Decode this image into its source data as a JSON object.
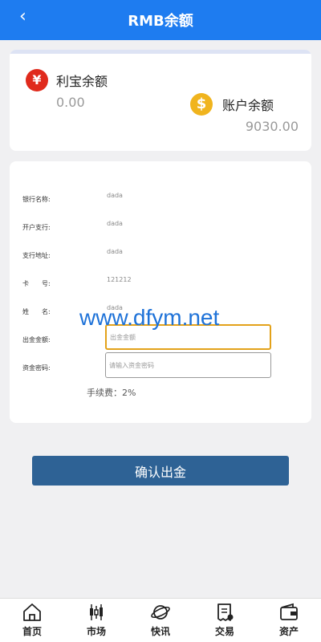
{
  "header": {
    "title": "RMB余额",
    "back_glyph": "‹"
  },
  "balances": {
    "profit": {
      "label": "利宝余额",
      "value": "0.00",
      "icon": "yuan-coin-icon",
      "icon_glyph": "¥"
    },
    "account": {
      "label": "账户余额",
      "value": "9030.00",
      "icon": "dollar-coin-icon",
      "icon_glyph": "$"
    }
  },
  "form": {
    "bank_name": {
      "label": "银行名称:",
      "value": "dada"
    },
    "branch": {
      "label": "开户支行:",
      "value": "dada"
    },
    "branch_address": {
      "label": "支行地址:",
      "value": "dada"
    },
    "card_no": {
      "label": "卡　　号:",
      "value": "121212"
    },
    "name": {
      "label": "姓　　名:",
      "value": "dada"
    },
    "amount": {
      "label": "出金金额:",
      "placeholder": "出金金额",
      "value": ""
    },
    "password": {
      "label": "资金密码:",
      "placeholder": "请输入资金密码",
      "value": ""
    },
    "fee": "手续费：2%"
  },
  "confirm_label": "确认出金",
  "watermark": "www.dfym.net",
  "tabs": [
    {
      "label": "首页",
      "icon": "home-icon"
    },
    {
      "label": "市场",
      "icon": "candlestick-icon"
    },
    {
      "label": "快讯",
      "icon": "planet-icon"
    },
    {
      "label": "交易",
      "icon": "receipt-icon"
    },
    {
      "label": "资产",
      "icon": "wallet-icon"
    }
  ],
  "colors": {
    "primary": "#1e7cf0",
    "button": "#2e6295",
    "focus": "#e3a21a"
  }
}
